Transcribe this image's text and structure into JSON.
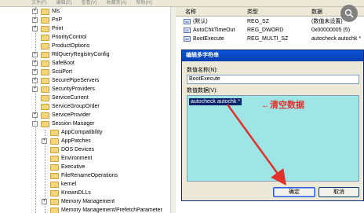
{
  "menubar": {
    "items": [
      "文件(F)",
      "编辑(E)",
      "查看(V)",
      "收藏夹(A)",
      "帮助(H)"
    ]
  },
  "tree": {
    "items": [
      {
        "label": "Nls",
        "expander": "+"
      },
      {
        "label": "PnP",
        "expander": "+"
      },
      {
        "label": "Print",
        "expander": "+"
      },
      {
        "label": "PriorityControl",
        "expander": ""
      },
      {
        "label": "ProductOptions",
        "expander": ""
      },
      {
        "label": "RtlQueryRegistryConfig",
        "expander": "+"
      },
      {
        "label": "SafeBoot",
        "expander": "+"
      },
      {
        "label": "ScsiPort",
        "expander": "+"
      },
      {
        "label": "SecurePipeServers",
        "expander": "+"
      },
      {
        "label": "SecurityProviders",
        "expander": "+"
      },
      {
        "label": "ServiceCurrent",
        "expander": ""
      },
      {
        "label": "ServiceGroupOrder",
        "expander": ""
      },
      {
        "label": "ServiceProvider",
        "expander": "+"
      },
      {
        "label": "Session Manager",
        "expander": "-"
      },
      {
        "label": "AppCompatibility",
        "expander": ""
      },
      {
        "label": "AppPatches",
        "expander": "+"
      },
      {
        "label": "DOS Devices",
        "expander": ""
      },
      {
        "label": "Environment",
        "expander": ""
      },
      {
        "label": "Executive",
        "expander": ""
      },
      {
        "label": "FileRenameOperations",
        "expander": ""
      },
      {
        "label": "kernel",
        "expander": ""
      },
      {
        "label": "KnownDLLs",
        "expander": ""
      },
      {
        "label": "Memory Management",
        "expander": "+"
      },
      {
        "label": "Memory Management/PrefetchParameter",
        "expander": ""
      }
    ]
  },
  "list": {
    "headers": {
      "name": "名称",
      "type": "类型",
      "data": "数据"
    },
    "rows": [
      {
        "icon": "ab",
        "name": "(默认)",
        "type": "REG_SZ",
        "data": "(数值未设置)"
      },
      {
        "icon": "01",
        "name": "AutoChkTimeOut",
        "type": "REG_DWORD",
        "data": "0x00000005 (5)"
      },
      {
        "icon": "ab",
        "name": "BootExecute",
        "type": "REG_MULTI_SZ",
        "data": "autocheck autochk *"
      }
    ]
  },
  "dialog": {
    "title": "编辑多字符串",
    "name_label": "数值名称(N):",
    "name_value": "BootExecute",
    "data_label": "数值数据(V):",
    "selected_text": "autocheck autochk *",
    "annotation": "←清空数据",
    "ok_label": "确定",
    "cancel_label": "取消"
  },
  "colors": {
    "annotation": "#e0312b",
    "arrow": "#e0312b",
    "data_area": "#9ee6e6",
    "title_bar": "#0a46c4"
  }
}
